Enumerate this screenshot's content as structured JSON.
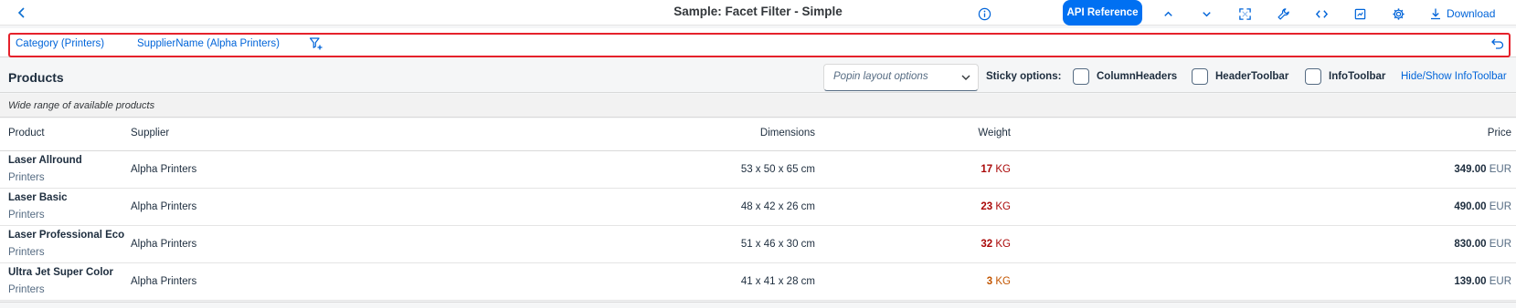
{
  "header": {
    "title": "Sample: Facet Filter - Simple",
    "api_reference": "API Reference",
    "download": "Download"
  },
  "facets": {
    "category": "Category (Printers)",
    "supplier": "SupplierName (Alpha Printers)"
  },
  "toolbar": {
    "title": "Products",
    "popin_placeholder": "Popin layout options",
    "sticky_label": "Sticky options:",
    "column_headers": "ColumnHeaders",
    "header_toolbar": "HeaderToolbar",
    "info_toolbar": "InfoToolbar",
    "hide_show": "Hide/Show InfoToolbar"
  },
  "info": "Wide range of available products",
  "columns": {
    "product": "Product",
    "supplier": "Supplier",
    "dimensions": "Dimensions",
    "weight": "Weight",
    "price": "Price"
  },
  "rows": [
    {
      "name": "Laser Allround",
      "category": "Printers",
      "supplier": "Alpha Printers",
      "dimensions": "53 x 50 x 65 cm",
      "weight": "17",
      "weight_unit": "KG",
      "price": "349.00",
      "currency": "EUR"
    },
    {
      "name": "Laser Basic",
      "category": "Printers",
      "supplier": "Alpha Printers",
      "dimensions": "48 x 42 x 26 cm",
      "weight": "23",
      "weight_unit": "KG",
      "price": "490.00",
      "currency": "EUR"
    },
    {
      "name": "Laser Professional Eco",
      "category": "Printers",
      "supplier": "Alpha Printers",
      "dimensions": "51 x 46 x 30 cm",
      "weight": "32",
      "weight_unit": "KG",
      "price": "830.00",
      "currency": "EUR"
    },
    {
      "name": "Ultra Jet Super Color",
      "category": "Printers",
      "supplier": "Alpha Printers",
      "dimensions": "41 x 41 x 28 cm",
      "weight": "3",
      "weight_unit": "KG",
      "price": "139.00",
      "currency": "EUR"
    }
  ],
  "colors": {
    "accent": "#0064d9",
    "button": "#0070f2",
    "error": "#aa0808",
    "warning": "#c35500",
    "highlight": "#e5212b"
  }
}
